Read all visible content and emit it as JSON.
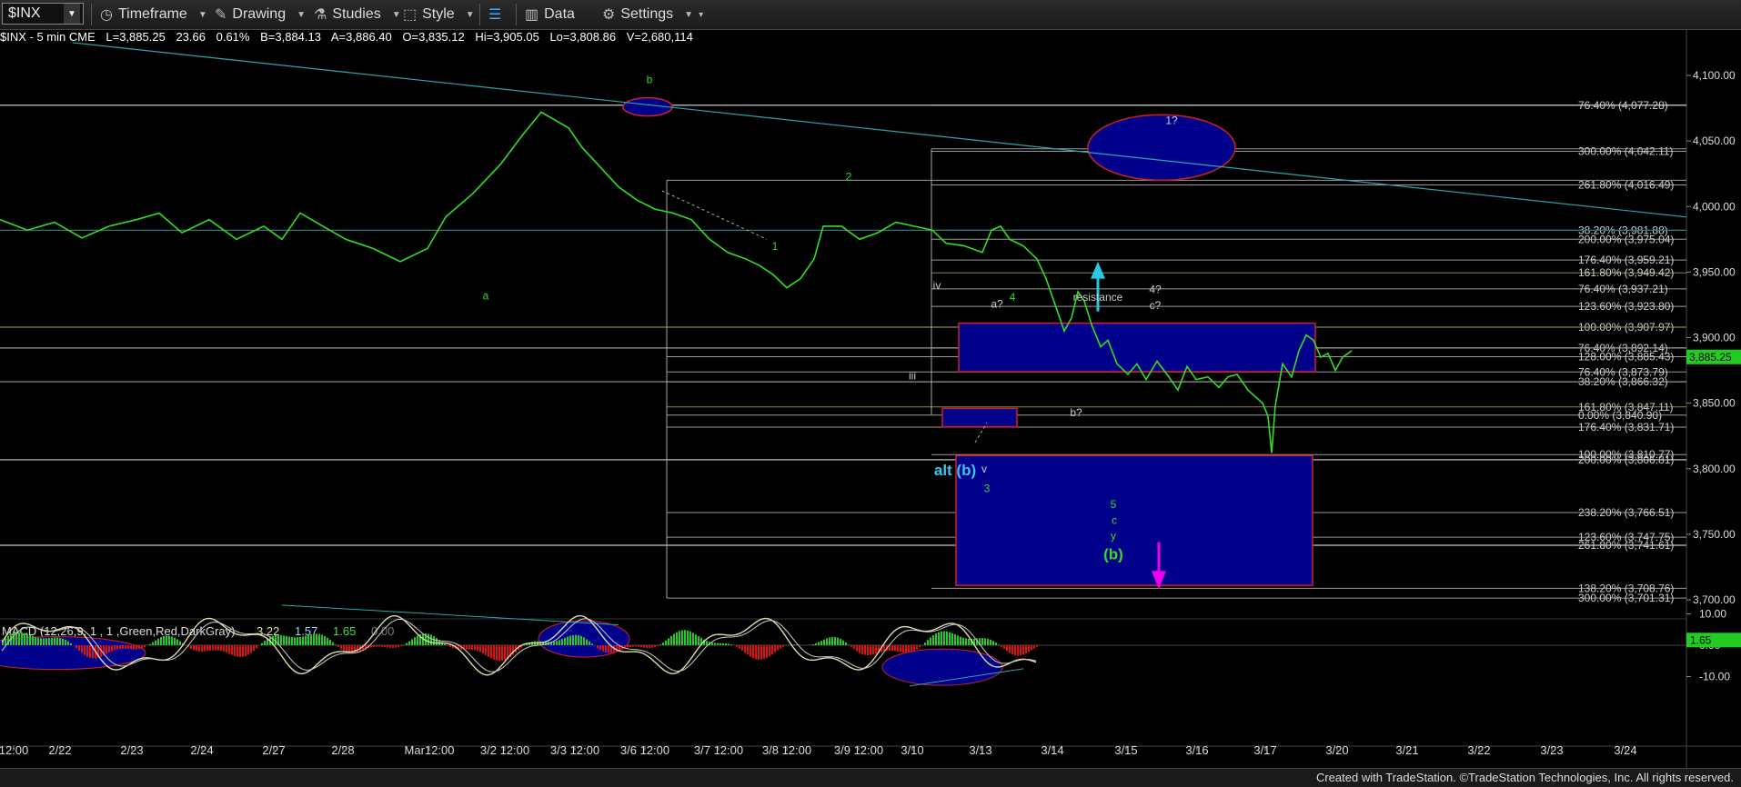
{
  "toolbar": {
    "symbol": "$INX",
    "items": [
      {
        "label": "Timeframe",
        "icon": "clock-icon"
      },
      {
        "label": "Drawing",
        "icon": "pencil-icon"
      },
      {
        "label": "Studies",
        "icon": "flask-icon"
      },
      {
        "label": "Style",
        "icon": "style-icon"
      },
      {
        "label": "",
        "icon": "layout-icon"
      },
      {
        "label": "Data",
        "icon": "bar-chart-icon"
      },
      {
        "label": "Settings",
        "icon": "gear-icon"
      }
    ]
  },
  "quote": {
    "symbol": "$INX - 5 min  CME",
    "last": "L=3,885.25",
    "change": "23.66",
    "pct": "0.61%",
    "bid": "B=3,884.13",
    "ask": "A=3,886.40",
    "open": "O=3,835.12",
    "high": "Hi=3,905.05",
    "low": "Lo=3,808.86",
    "volume": "V=2,680,114"
  },
  "footer": "Created with TradeStation. ©TradeStation Technologies, Inc. All rights reserved.",
  "colors": {
    "price": "#33dd22",
    "fib_box": "#00008b",
    "fib_box_border": "#cc2222",
    "trendline": "#2aa7a7",
    "cyan_label": "#39c6f0",
    "magenta": "#ee00ee",
    "macd_green": "#22cc22",
    "macd_red": "#dd1111",
    "macd_line1": "#ddddaa",
    "macd_line2": "#cccccc"
  },
  "chart_data": {
    "type": "line",
    "title": "$INX - 5 min",
    "price_axis": {
      "ticks": [
        "4,100.00",
        "4,050.00",
        "4,000.00",
        "3,950.00",
        "3,900.00",
        "3,850.00",
        "3,800.00",
        "3,750.00",
        "3,700.00"
      ],
      "ylim": [
        3680,
        4122
      ]
    },
    "current_price_label": "3,885.25",
    "x_tick_labels": [
      "12:00",
      "2/22",
      "2/23",
      "2/24",
      "2/27",
      "2/28",
      "Mar12:00",
      "3/2 12:00",
      "3/3 12:00",
      "3/6 12:00",
      "3/7 12:00",
      "3/8 12:00",
      "3/9 12:00",
      "3/10",
      "3/13",
      "3/14",
      "3/15",
      "3/16",
      "3/17",
      "3/20",
      "3/21",
      "3/22",
      "3/23",
      "3/24"
    ],
    "price_series_points": [
      [
        0,
        3990
      ],
      [
        30,
        3982
      ],
      [
        60,
        3988
      ],
      [
        90,
        3976
      ],
      [
        120,
        3985
      ],
      [
        150,
        3990
      ],
      [
        175,
        3995
      ],
      [
        200,
        3980
      ],
      [
        230,
        3990
      ],
      [
        260,
        3975
      ],
      [
        290,
        3985
      ],
      [
        310,
        3975
      ],
      [
        330,
        3995
      ],
      [
        355,
        3985
      ],
      [
        380,
        3975
      ],
      [
        410,
        3968
      ],
      [
        440,
        3958
      ],
      [
        470,
        3968
      ],
      [
        490,
        3992
      ],
      [
        520,
        4010
      ],
      [
        550,
        4032
      ],
      [
        575,
        4055
      ],
      [
        595,
        4072
      ],
      [
        610,
        4066
      ],
      [
        625,
        4060
      ],
      [
        640,
        4045
      ],
      [
        660,
        4030
      ],
      [
        680,
        4015
      ],
      [
        700,
        4005
      ],
      [
        720,
        3998
      ],
      [
        740,
        3995
      ],
      [
        760,
        3990
      ],
      [
        780,
        3975
      ],
      [
        800,
        3965
      ],
      [
        820,
        3960
      ],
      [
        835,
        3955
      ],
      [
        850,
        3948
      ],
      [
        865,
        3938
      ],
      [
        880,
        3945
      ],
      [
        895,
        3960
      ],
      [
        905,
        3985
      ],
      [
        925,
        3985
      ],
      [
        945,
        3975
      ],
      [
        965,
        3980
      ],
      [
        985,
        3988
      ],
      [
        1005,
        3985
      ],
      [
        1025,
        3982
      ],
      [
        1040,
        3972
      ],
      [
        1060,
        3970
      ],
      [
        1080,
        3965
      ],
      [
        1090,
        3982
      ],
      [
        1100,
        3985
      ],
      [
        1110,
        3975
      ],
      [
        1125,
        3970
      ],
      [
        1140,
        3960
      ],
      [
        1150,
        3945
      ],
      [
        1160,
        3925
      ],
      [
        1170,
        3905
      ],
      [
        1178,
        3915
      ],
      [
        1185,
        3935
      ],
      [
        1192,
        3928
      ],
      [
        1200,
        3910
      ],
      [
        1210,
        3893
      ],
      [
        1218,
        3898
      ],
      [
        1228,
        3880
      ],
      [
        1240,
        3872
      ],
      [
        1250,
        3880
      ],
      [
        1260,
        3868
      ],
      [
        1272,
        3882
      ],
      [
        1285,
        3870
      ],
      [
        1295,
        3860
      ],
      [
        1305,
        3878
      ],
      [
        1315,
        3868
      ],
      [
        1328,
        3870
      ],
      [
        1340,
        3862
      ],
      [
        1350,
        3870
      ],
      [
        1360,
        3872
      ],
      [
        1372,
        3860
      ],
      [
        1380,
        3855
      ],
      [
        1388,
        3850
      ],
      [
        1394,
        3840
      ],
      [
        1398,
        3812
      ],
      [
        1402,
        3848
      ],
      [
        1410,
        3880
      ],
      [
        1420,
        3870
      ],
      [
        1428,
        3890
      ],
      [
        1436,
        3902
      ],
      [
        1444,
        3898
      ],
      [
        1452,
        3885
      ],
      [
        1460,
        3888
      ],
      [
        1468,
        3875
      ],
      [
        1476,
        3885
      ],
      [
        1486,
        3890
      ]
    ],
    "fib_levels_right": [
      {
        "label": "76.40% (4,077.28)",
        "value": 4077.28
      },
      {
        "label": "300.00% (4,042.11)",
        "value": 4042.11
      },
      {
        "label": "261.80% (4,016.49)",
        "value": 4016.49
      },
      {
        "label": "38.20% (3,981.88)",
        "value": 3981.88
      },
      {
        "label": "200.00% (3,975.04)",
        "value": 3975.04
      },
      {
        "label": "176.40% (3,959.21)",
        "value": 3959.21
      },
      {
        "label": "161.80% (3,949.42)",
        "value": 3949.42
      },
      {
        "label": "76.40% (3,937.21)",
        "value": 3937.21
      },
      {
        "label": "123.60% (3,923.80)",
        "value": 3923.8
      },
      {
        "label": "100.00% (3,907.97)",
        "value": 3907.97
      },
      {
        "label": "76.40% (3,892.14)",
        "value": 3892.14
      },
      {
        "label": "128.00% (3,885.43)",
        "value": 3885.43
      },
      {
        "label": "76.40% (3,873.79)",
        "value": 3873.79
      },
      {
        "label": "38.20% (3,866.32)",
        "value": 3866.32
      },
      {
        "label": "161.80% (3,847.11)",
        "value": 3847.11
      },
      {
        "label": "0.00% (3,840.90)",
        "value": 3840.9
      },
      {
        "label": "176.40% (3,831.71)",
        "value": 3831.71
      },
      {
        "label": "100.00% (3,810.77)",
        "value": 3810.77
      },
      {
        "label": "200.00% (3,806.81)",
        "value": 3806.81
      },
      {
        "label": "238.20% (3,766.51)",
        "value": 3766.51
      },
      {
        "label": "123.60% (3,747.75)",
        "value": 3747.75
      },
      {
        "label": "261.80% (3,741.61)",
        "value": 3741.61
      },
      {
        "label": "138.20% (3,708.76)",
        "value": 3708.76
      },
      {
        "label": "300.00% (3,701.31)",
        "value": 3701.31
      }
    ],
    "wave_labels": [
      {
        "text": "b",
        "x": 714,
        "y": 4094,
        "color": "#33dd22"
      },
      {
        "text": "a",
        "x": 534,
        "y": 3929,
        "color": "#33dd22"
      },
      {
        "text": "1",
        "x": 852,
        "y": 3967,
        "color": "#33dd22"
      },
      {
        "text": "2",
        "x": 933,
        "y": 4020,
        "color": "#33dd22"
      },
      {
        "text": "iv",
        "x": 1030,
        "y": 3937,
        "color": "#cccccc"
      },
      {
        "text": "iii",
        "x": 1003,
        "y": 3868,
        "color": "#cccccc"
      },
      {
        "text": "a?",
        "x": 1096,
        "y": 3923,
        "color": "#cccccc"
      },
      {
        "text": "4",
        "x": 1113,
        "y": 3928,
        "color": "#33dd22"
      },
      {
        "text": "v",
        "x": 1082,
        "y": 3797,
        "color": "#cccccc"
      },
      {
        "text": "3",
        "x": 1085,
        "y": 3782,
        "color": "#33dd22"
      },
      {
        "text": "b?",
        "x": 1183,
        "y": 3840,
        "color": "#cccccc"
      },
      {
        "text": "resistance",
        "x": 1207,
        "y": 3928,
        "color": "#cccccc"
      },
      {
        "text": "4?",
        "x": 1270,
        "y": 3934,
        "color": "#cccccc"
      },
      {
        "text": "c?",
        "x": 1270,
        "y": 3922,
        "color": "#cccccc"
      },
      {
        "text": "5",
        "x": 1224,
        "y": 3770,
        "color": "#33dd22"
      },
      {
        "text": "c",
        "x": 1225,
        "y": 3758,
        "color": "#33dd22"
      },
      {
        "text": "y",
        "x": 1224,
        "y": 3746,
        "color": "#33dd22"
      },
      {
        "text": "(b)",
        "x": 1224,
        "y": 3731,
        "color": "#33dd22"
      },
      {
        "text": "alt (b)",
        "x": 1050,
        "y": 3795,
        "color": "#39c6f0"
      },
      {
        "text": "1?",
        "x": 1288,
        "y": 4063,
        "color": "#cccccc"
      }
    ],
    "macd": {
      "title": "MACD (12,26,9, 1 , 1 ,Green,Red,DarkGray)",
      "values": [
        "3.22",
        "1.57",
        "1.65",
        "0.00"
      ],
      "ticks": [
        "10.00",
        "0.00",
        "-10.00"
      ],
      "current_label": "1.65",
      "ylim": [
        -13,
        13
      ]
    }
  }
}
